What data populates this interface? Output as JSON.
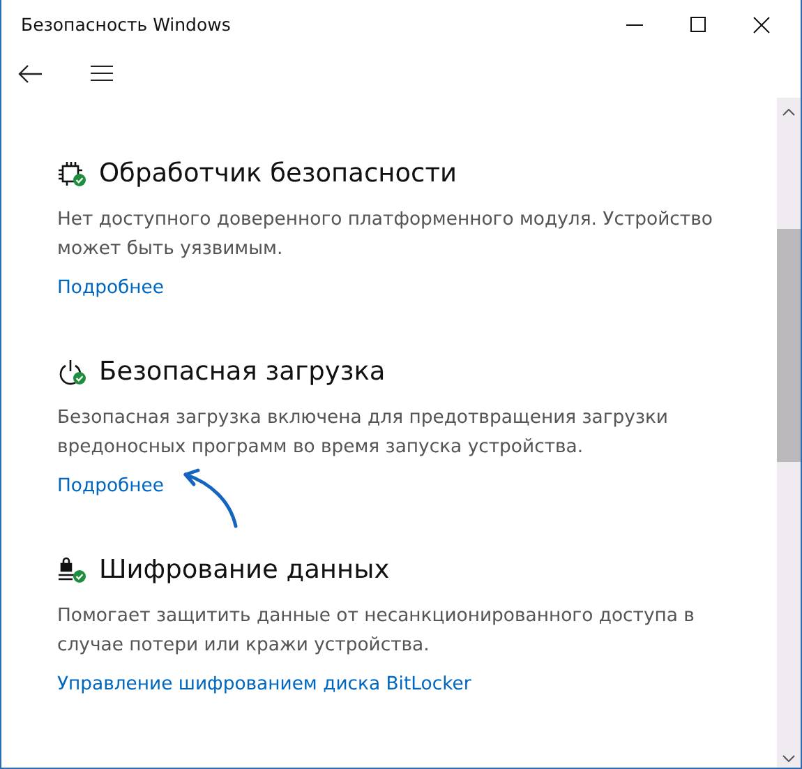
{
  "window": {
    "title": "Безопасность Windows"
  },
  "sections": [
    {
      "kind": "chip",
      "title": "Обработчик безопасности",
      "description": "Нет доступного доверенного платформенного модуля. Устройство может быть уязвимым.",
      "link": "Подробнее"
    },
    {
      "kind": "power",
      "title": "Безопасная загрузка",
      "description": "Безопасная загрузка включена для предотвращения загрузки вредоносных программ во время запуска устройства.",
      "link": "Подробнее"
    },
    {
      "kind": "lock",
      "title": "Шифрование данных",
      "description": "Помогает защитить данные от несанкционированного доступа в случае потери или кражи устройства.",
      "link": "Управление шифрованием диска BitLocker"
    }
  ]
}
